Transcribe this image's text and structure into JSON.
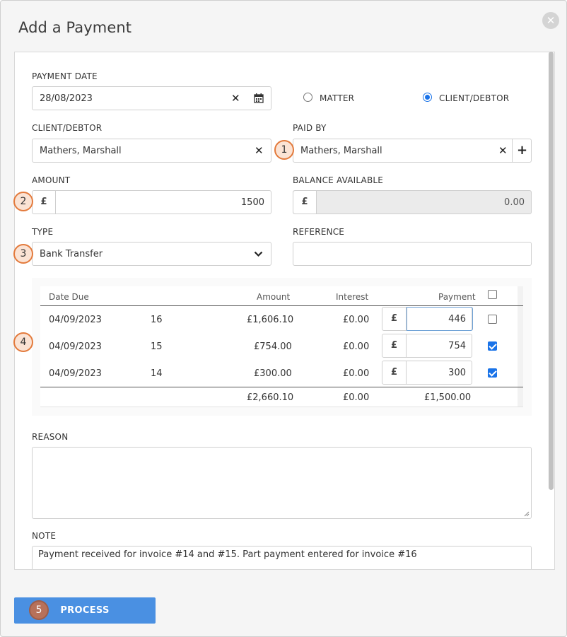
{
  "dialog": {
    "title": "Add a Payment",
    "close_icon": "close-icon"
  },
  "form": {
    "payment_date_label": "PAYMENT DATE",
    "payment_date_value": "28/08/2023",
    "radio_matter_label": "MATTER",
    "radio_client_label": "CLIENT/DEBTOR",
    "radio_selected": "CLIENT/DEBTOR",
    "client_debtor_label": "CLIENT/DEBTOR",
    "client_debtor_value": "Mathers, Marshall",
    "paid_by_label": "PAID BY",
    "paid_by_value": "Mathers, Marshall",
    "amount_label": "AMOUNT",
    "amount_currency": "£",
    "amount_value": "1500",
    "balance_label": "BALANCE AVAILABLE",
    "balance_currency": "£",
    "balance_value": "0.00",
    "type_label": "TYPE",
    "type_value": "Bank Transfer",
    "reference_label": "REFERENCE",
    "reference_value": "",
    "reason_label": "REASON",
    "reason_value": "",
    "note_label": "NOTE",
    "note_value": "Payment received for invoice #14 and #15. Part payment entered for invoice #16"
  },
  "table": {
    "headers": {
      "date_due": "Date Due",
      "amount": "Amount",
      "interest": "Interest",
      "payment": "Payment"
    },
    "rows": [
      {
        "date": "04/09/2023",
        "invoice": "16",
        "amount": "£1,606.10",
        "interest": "£0.00",
        "currency": "£",
        "payment": "446",
        "checked": false
      },
      {
        "date": "04/09/2023",
        "invoice": "15",
        "amount": "£754.00",
        "interest": "£0.00",
        "currency": "£",
        "payment": "754",
        "checked": true
      },
      {
        "date": "04/09/2023",
        "invoice": "14",
        "amount": "£300.00",
        "interest": "£0.00",
        "currency": "£",
        "payment": "300",
        "checked": true
      }
    ],
    "totals": {
      "amount": "£2,660.10",
      "interest": "£0.00",
      "payment": "£1,500.00"
    }
  },
  "badges": [
    "1",
    "2",
    "3",
    "4",
    "5"
  ],
  "actions": {
    "process_label": "PROCESS"
  },
  "colors": {
    "accent": "#4a90e2",
    "checkbox": "#1a73e8",
    "badge_border": "#e37a3c"
  }
}
